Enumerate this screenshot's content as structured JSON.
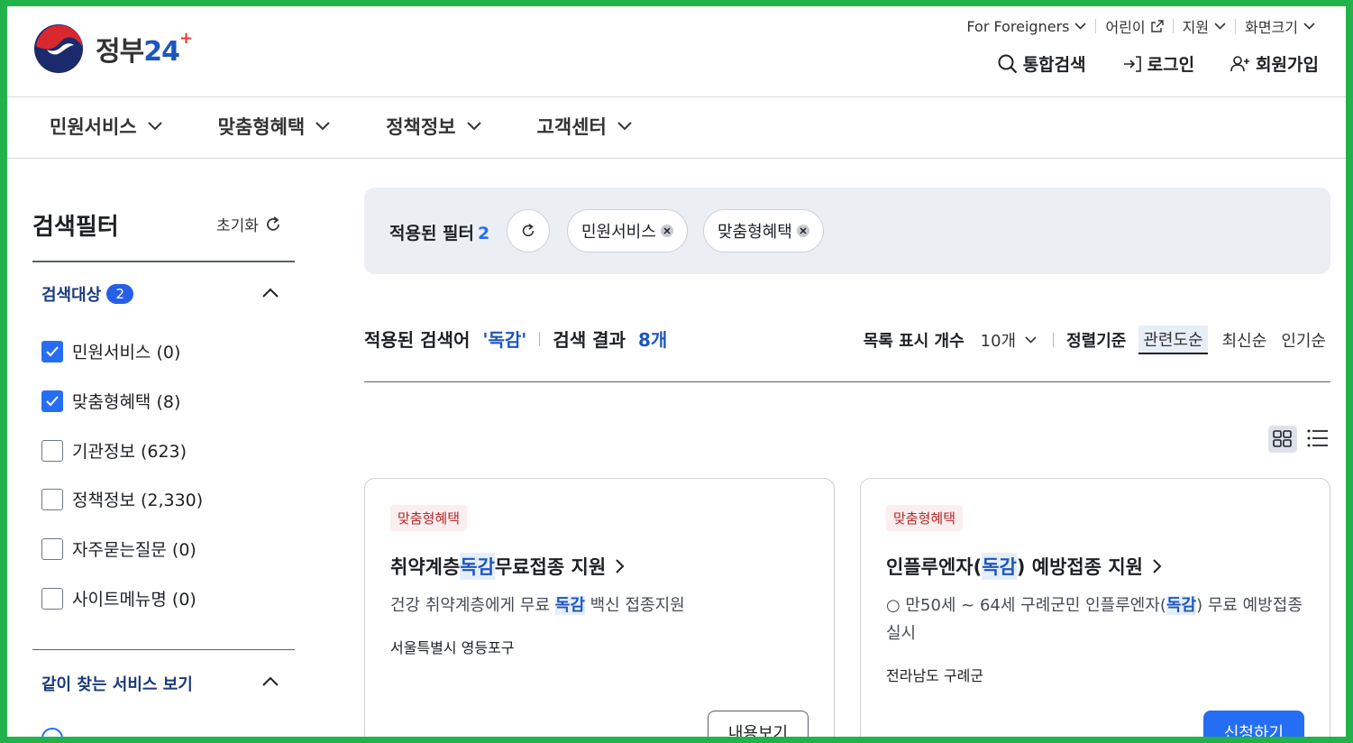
{
  "logo": {
    "text": "정부",
    "num": "24"
  },
  "util": {
    "foreigners": "For Foreigners",
    "kids": "어린이",
    "support": "지원",
    "screen": "화면크기"
  },
  "actions": {
    "search": "통합검색",
    "login": "로그인",
    "signup": "회원가입"
  },
  "gnb": [
    "민원서비스",
    "맞춤형혜택",
    "정책정보",
    "고객센터"
  ],
  "sidebar": {
    "title": "검색필터",
    "reset": "초기화",
    "target": {
      "label": "검색대상",
      "count": "2"
    },
    "items": [
      {
        "label": "민원서비스 (0)",
        "checked": true
      },
      {
        "label": "맞춤형혜택 (8)",
        "checked": true
      },
      {
        "label": "기관정보 (623)",
        "checked": false
      },
      {
        "label": "정책정보 (2,330)",
        "checked": false
      },
      {
        "label": "자주묻는질문 (0)",
        "checked": false
      },
      {
        "label": "사이트메뉴명 (0)",
        "checked": false
      }
    ],
    "related": "같이 찾는 서비스 보기",
    "radio_partial": "...."
  },
  "filterbar": {
    "label": "적용된 필터",
    "count": "2",
    "chips": [
      "민원서비스",
      "맞춤형혜택"
    ]
  },
  "results": {
    "kw_label": "적용된 검색어",
    "keyword": "'독감'",
    "count_label": "검색 결과",
    "count": "8개"
  },
  "sort": {
    "list_label": "목록 표시 개수",
    "list_value": "10개",
    "sort_label": "정렬기준",
    "options": [
      "관련도순",
      "최신순",
      "인기순"
    ]
  },
  "cards": [
    {
      "tag": "맞춤형혜택",
      "title_pre": "취약계층 ",
      "title_hl": "독감",
      "title_post": " 무료접종 지원",
      "desc_pre": "건강 취약계층에게 무료 ",
      "desc_hl": "독감",
      "desc_post": " 백신 접종지원",
      "org": "서울특별시 영등포구",
      "button": "내용보기"
    },
    {
      "tag": "맞춤형혜택",
      "title_pre": "인플루엔자(",
      "title_hl": "독감",
      "title_post": ") 예방접종 지원",
      "desc_pre": "○ 만50세 ~ 64세 구례군민 인플루엔자(",
      "desc_hl": "독감",
      "desc_post": ") 무료 예방접종 실시",
      "org": "전라남도 구례군",
      "button": "신청하기"
    }
  ]
}
